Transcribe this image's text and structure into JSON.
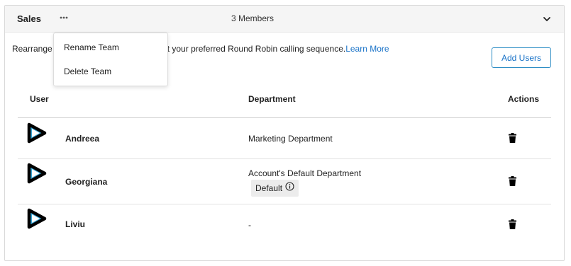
{
  "team": {
    "name": "Sales",
    "members_label": "3 Members"
  },
  "menu": {
    "items": [
      "Rename Team",
      "Delete Team"
    ]
  },
  "description": {
    "visible_text": "Rearrange",
    "text_after_menu": "to set your preferred Round Robin calling sequence.",
    "link": "Learn More"
  },
  "actions": {
    "add_users": "Add Users"
  },
  "table": {
    "headers": {
      "user": "User",
      "department": "Department",
      "actions": "Actions"
    },
    "rows": [
      {
        "user": "Andreea",
        "department": "Marketing Department",
        "badge": ""
      },
      {
        "user": "Georgiana",
        "department": "Account's Default Department",
        "badge": "Default"
      },
      {
        "user": "Liviu",
        "department": "-",
        "badge": ""
      }
    ]
  },
  "colors": {
    "accent": "#1a73c8",
    "avatar_fill": "#38a6d6",
    "avatar_outline": "#000000"
  },
  "icons": {
    "more": "more-horizontal-icon",
    "collapse": "chevron-down-icon",
    "avatar": "play-icon",
    "delete": "trash-icon",
    "info": "info-icon"
  }
}
